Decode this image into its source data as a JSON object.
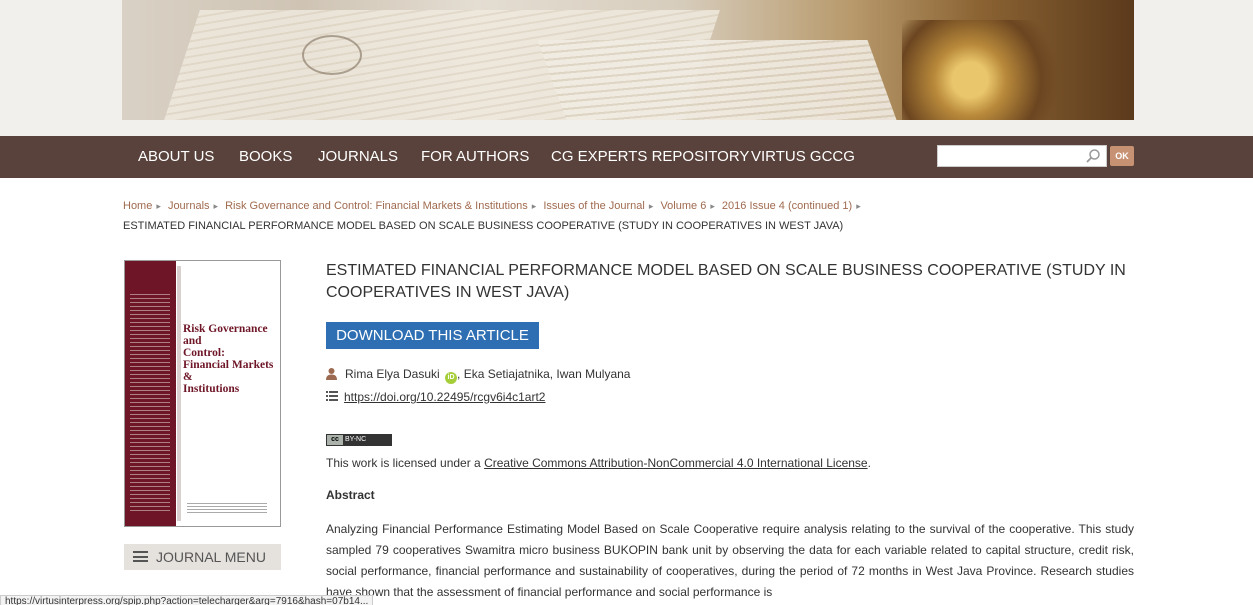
{
  "nav": {
    "items": [
      "ABOUT US",
      "BOOKS",
      "JOURNALS",
      "FOR AUTHORS",
      "CG EXPERTS REPOSITORY",
      "VIRTUS GCCG"
    ],
    "search_placeholder": "",
    "ok_label": "OK"
  },
  "breadcrumbs": {
    "items": [
      "Home",
      "Journals",
      "Risk Governance and Control: Financial Markets & Institutions",
      "Issues of the Journal",
      "Volume 6",
      "2016 Issue 4 (continued 1)"
    ],
    "current": "ESTIMATED FINANCIAL PERFORMANCE MODEL BASED ON SCALE BUSINESS COOPERATIVE (STUDY IN COOPERATIVES IN WEST JAVA)"
  },
  "cover": {
    "title_lines": [
      "Risk Governance and",
      "Control:",
      "Financial Markets &",
      "Institutions"
    ]
  },
  "sidebar": {
    "journal_menu_label": "JOURNAL MENU"
  },
  "article": {
    "title": "ESTIMATED FINANCIAL PERFORMANCE MODEL BASED ON SCALE BUSINESS COOPERATIVE (STUDY IN COOPERATIVES IN WEST JAVA)",
    "download_label": "DOWNLOAD THIS ARTICLE",
    "author_first": "Rima Elya Dasuki",
    "authors_rest": ", Eka Setiajatnika, Iwan Mulyana",
    "doi": "https://doi.org/10.22495/rcgv6i4c1art2",
    "cc_label": "cc",
    "cc_terms": "BY-NC",
    "license_prefix": "This work is licensed under a ",
    "license_link": "Creative Commons Attribution-NonCommercial 4.0 International License",
    "license_suffix": ".",
    "abstract_heading": "Abstract",
    "abstract": "Analyzing Financial Performance Estimating Model Based on Scale Cooperative require analysis relating to the survival of the cooperative. This study sampled 79 cooperatives Swamitra micro business BUKOPIN bank unit by observing the data for each variable related to capital structure, credit risk, social performance, financial performance and sustainability of cooperatives, during the period of 72 months in West Java Province. Research studies have shown that the assessment of financial performance and social performance is"
  },
  "status_bar": {
    "url": "https://virtusinterpress.org/spip.php?action=telecharger&arg=7916&hash=07b14..."
  },
  "colors": {
    "nav_bg": "#58423b",
    "accent_button": "#2e6fb3",
    "cover_maroon": "#6e1627",
    "breadcrumb_link": "#a06a4e"
  }
}
